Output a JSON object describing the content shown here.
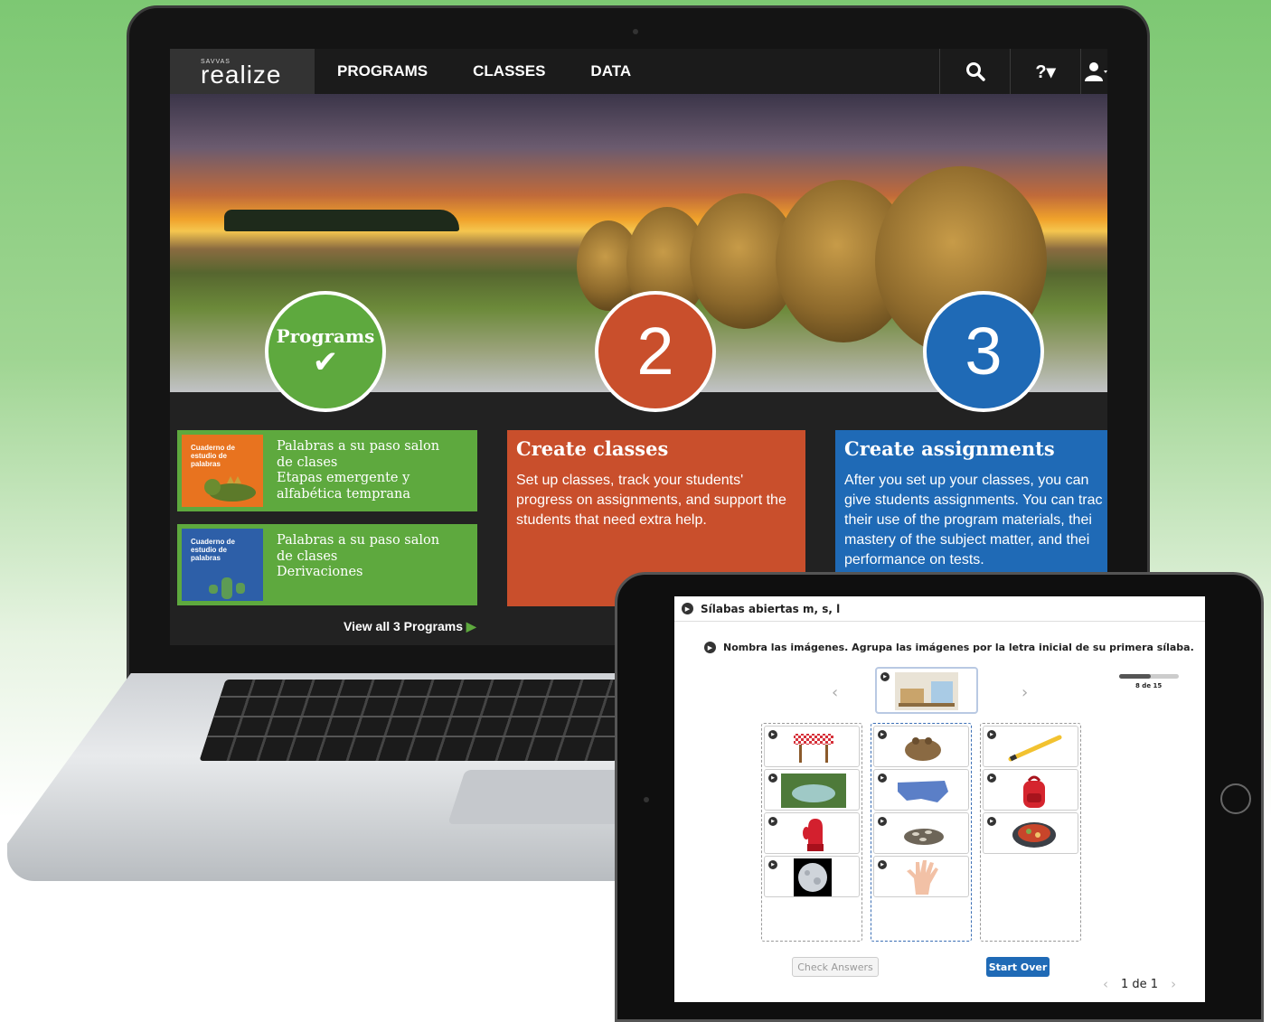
{
  "laptop": {
    "nav": {
      "logo_small": "SAVVAS",
      "logo_main": "realize",
      "links": [
        "PROGRAMS",
        "CLASSES",
        "DATA"
      ],
      "help_label": "?▾"
    },
    "steps": [
      {
        "label": "Programs",
        "check": "✔",
        "color": "#5ea93e"
      },
      {
        "label": "2",
        "color": "#c94f2c"
      },
      {
        "label": "3",
        "color": "#1f6ab6"
      }
    ],
    "programs": [
      {
        "thumb_title": "Cuaderno de estudio de palabras",
        "lines": [
          "Palabras a su paso salon",
          "de clases",
          "Etapas emergente y",
          "alfabética temprana"
        ]
      },
      {
        "thumb_title": "Cuaderno de estudio de palabras",
        "lines": [
          "Palabras a su paso salon",
          "de clases",
          "Derivaciones"
        ]
      }
    ],
    "view_all": "View all 3 Programs",
    "create_classes": {
      "title": "Create classes",
      "body": "Set up classes, track your students' progress on assignments, and support the students that need extra help."
    },
    "create_assignments": {
      "title": "Create assignments",
      "lines": [
        "After you set up your classes, you can",
        "give students assignments. You can trac",
        "their use of the program materials, thei",
        "mastery of the subject matter, and thei",
        "performance on tests."
      ]
    }
  },
  "tablet": {
    "header": "Sílabas abiertas m, s, l",
    "instruction": "Nombra las imágenes. Agrupa las imágenes por la letra inicial de su primera sílaba.",
    "progress_text": "8 de 15",
    "progress_fraction": 0.533,
    "check_answers": "Check Answers",
    "start_over": "Start Over",
    "pager": "1 de 1",
    "columns": [
      [
        "table-picture",
        "lake-picture",
        "mitten-picture",
        "moon-picture"
      ],
      [
        "toad-picture",
        "map-picture",
        "seeds-picture",
        "hand-picture"
      ],
      [
        "pencil-picture",
        "backpack-picture",
        "soup-picture"
      ]
    ]
  }
}
